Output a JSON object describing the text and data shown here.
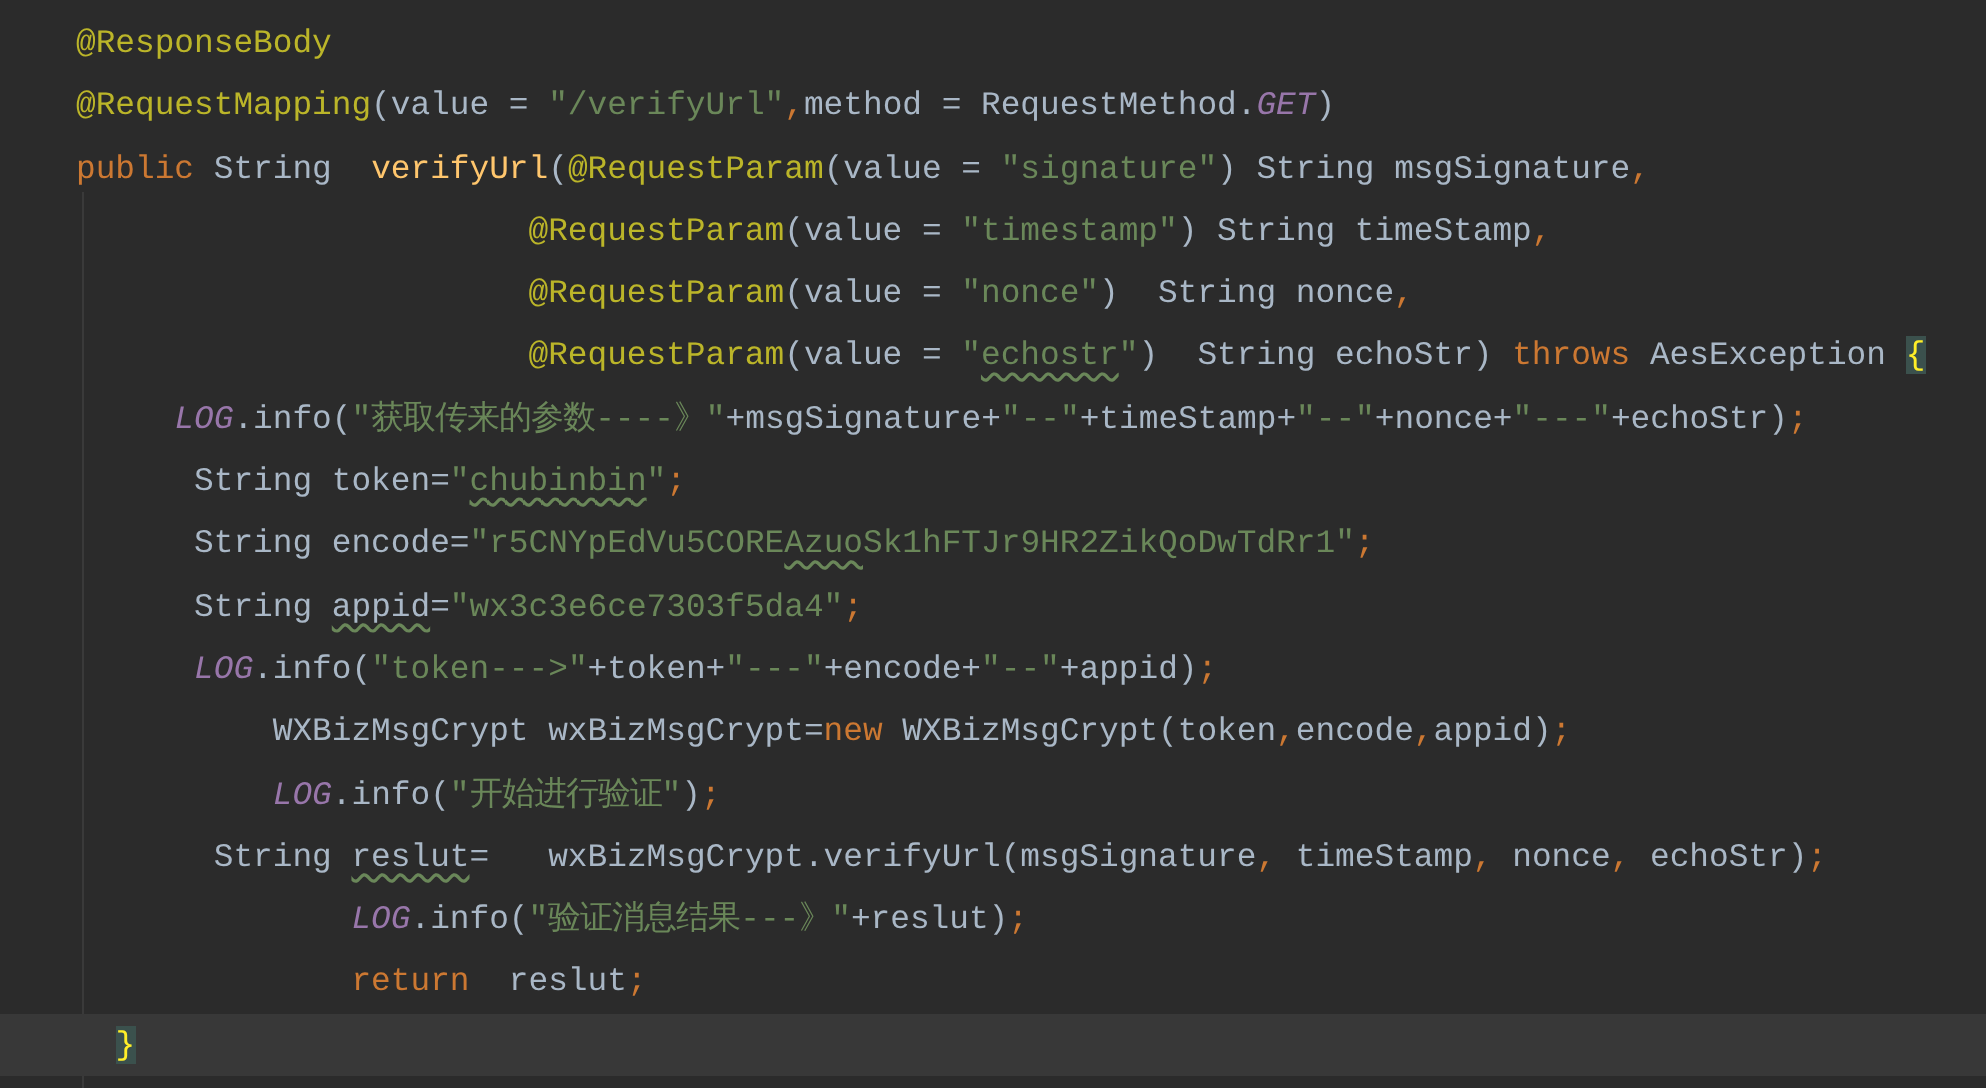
{
  "editor": {
    "lines": [
      {
        "current": false,
        "tokens": [
          {
            "kind": "annotation",
            "text": "@ResponseBody"
          }
        ]
      },
      {
        "current": false,
        "tokens": [
          {
            "kind": "annotation",
            "text": "@RequestMapping"
          },
          {
            "kind": "plain",
            "text": "(value = "
          },
          {
            "kind": "string",
            "text": "\"/verifyUrl\""
          },
          {
            "kind": "punct",
            "text": ","
          },
          {
            "kind": "plain",
            "text": "method = RequestMethod."
          },
          {
            "kind": "constant",
            "text": "GET"
          },
          {
            "kind": "plain",
            "text": ")"
          }
        ]
      },
      {
        "current": false,
        "tokens": [
          {
            "kind": "keyword",
            "text": "public "
          },
          {
            "kind": "plain",
            "text": "String  "
          },
          {
            "kind": "method",
            "text": "verifyUrl"
          },
          {
            "kind": "plain",
            "text": "("
          },
          {
            "kind": "annotation",
            "text": "@RequestParam"
          },
          {
            "kind": "plain",
            "text": "(value = "
          },
          {
            "kind": "string",
            "text": "\"signature\""
          },
          {
            "kind": "plain",
            "text": ") String msgSignature"
          },
          {
            "kind": "punct",
            "text": ","
          }
        ]
      },
      {
        "current": false,
        "tokens": [
          {
            "kind": "annotation",
            "text": "                       @RequestParam"
          },
          {
            "kind": "plain",
            "text": "(value = "
          },
          {
            "kind": "string",
            "text": "\"timestamp\""
          },
          {
            "kind": "plain",
            "text": ") String timeStamp"
          },
          {
            "kind": "punct",
            "text": ","
          }
        ]
      },
      {
        "current": false,
        "tokens": [
          {
            "kind": "annotation",
            "text": "                       @RequestParam"
          },
          {
            "kind": "plain",
            "text": "(value = "
          },
          {
            "kind": "string",
            "text": "\"nonce\""
          },
          {
            "kind": "plain",
            "text": ")  String nonce"
          },
          {
            "kind": "punct",
            "text": ","
          }
        ]
      },
      {
        "current": false,
        "tokens": [
          {
            "kind": "annotation",
            "text": "                       @RequestParam"
          },
          {
            "kind": "plain",
            "text": "(value = "
          },
          {
            "kind": "string",
            "text": "\""
          },
          {
            "kind": "string-typo",
            "text": "echostr"
          },
          {
            "kind": "string",
            "text": "\""
          },
          {
            "kind": "plain",
            "text": ")  String echoStr) "
          },
          {
            "kind": "keyword",
            "text": "throws "
          },
          {
            "kind": "plain",
            "text": "AesException "
          },
          {
            "kind": "brace",
            "text": "{"
          }
        ]
      },
      {
        "current": false,
        "tokens": [
          {
            "kind": "constant",
            "text": "     LOG"
          },
          {
            "kind": "plain",
            "text": ".info("
          },
          {
            "kind": "string",
            "text": "\"获取传来的参数----》\""
          },
          {
            "kind": "plain",
            "text": "+msgSignature+"
          },
          {
            "kind": "string",
            "text": "\"--\""
          },
          {
            "kind": "plain",
            "text": "+timeStamp+"
          },
          {
            "kind": "string",
            "text": "\"--\""
          },
          {
            "kind": "plain",
            "text": "+nonce+"
          },
          {
            "kind": "string",
            "text": "\"---\""
          },
          {
            "kind": "plain",
            "text": "+echoStr)"
          },
          {
            "kind": "punct",
            "text": ";"
          }
        ]
      },
      {
        "current": false,
        "tokens": [
          {
            "kind": "plain",
            "text": "      String token="
          },
          {
            "kind": "string",
            "text": "\""
          },
          {
            "kind": "string-typo",
            "text": "chubinbin"
          },
          {
            "kind": "string",
            "text": "\""
          },
          {
            "kind": "punct",
            "text": ";"
          }
        ]
      },
      {
        "current": false,
        "tokens": [
          {
            "kind": "plain",
            "text": "      String encode="
          },
          {
            "kind": "string",
            "text": "\"r5CNYpEdVu5CORE"
          },
          {
            "kind": "string-typo",
            "text": "Azuo"
          },
          {
            "kind": "string",
            "text": "Sk1hFTJr9HR2ZikQoDwTdRr1\""
          },
          {
            "kind": "punct",
            "text": ";"
          }
        ]
      },
      {
        "current": false,
        "tokens": [
          {
            "kind": "plain",
            "text": "      String "
          },
          {
            "kind": "plain-typo",
            "text": "appid"
          },
          {
            "kind": "plain",
            "text": "="
          },
          {
            "kind": "string",
            "text": "\"wx3c3e6ce7303f5da4\""
          },
          {
            "kind": "punct",
            "text": ";"
          }
        ]
      },
      {
        "current": false,
        "tokens": [
          {
            "kind": "constant",
            "text": "      LOG"
          },
          {
            "kind": "plain",
            "text": ".info("
          },
          {
            "kind": "string",
            "text": "\"token--->\""
          },
          {
            "kind": "plain",
            "text": "+token+"
          },
          {
            "kind": "string",
            "text": "\"---\""
          },
          {
            "kind": "plain",
            "text": "+encode+"
          },
          {
            "kind": "string",
            "text": "\"--\""
          },
          {
            "kind": "plain",
            "text": "+appid)"
          },
          {
            "kind": "punct",
            "text": ";"
          }
        ]
      },
      {
        "current": false,
        "tokens": [
          {
            "kind": "plain",
            "text": "          WXBizMsgCrypt wxBizMsgCrypt="
          },
          {
            "kind": "keyword",
            "text": "new "
          },
          {
            "kind": "plain",
            "text": "WXBizMsgCrypt(token"
          },
          {
            "kind": "punct",
            "text": ","
          },
          {
            "kind": "plain",
            "text": "encode"
          },
          {
            "kind": "punct",
            "text": ","
          },
          {
            "kind": "plain",
            "text": "appid)"
          },
          {
            "kind": "punct",
            "text": ";"
          }
        ]
      },
      {
        "current": false,
        "tokens": [
          {
            "kind": "constant",
            "text": "          LOG"
          },
          {
            "kind": "plain",
            "text": ".info("
          },
          {
            "kind": "string",
            "text": "\"开始进行验证\""
          },
          {
            "kind": "plain",
            "text": ")"
          },
          {
            "kind": "punct",
            "text": ";"
          }
        ]
      },
      {
        "current": false,
        "tokens": [
          {
            "kind": "plain",
            "text": "       String "
          },
          {
            "kind": "plain-typo",
            "text": "reslut"
          },
          {
            "kind": "plain",
            "text": "=   wxBizMsgCrypt.verifyUrl(msgSignature"
          },
          {
            "kind": "punct",
            "text": ","
          },
          {
            "kind": "plain",
            "text": " timeStamp"
          },
          {
            "kind": "punct",
            "text": ","
          },
          {
            "kind": "plain",
            "text": " nonce"
          },
          {
            "kind": "punct",
            "text": ","
          },
          {
            "kind": "plain",
            "text": " echoStr)"
          },
          {
            "kind": "punct",
            "text": ";"
          }
        ]
      },
      {
        "current": false,
        "tokens": [
          {
            "kind": "constant",
            "text": "              LOG"
          },
          {
            "kind": "plain",
            "text": ".info("
          },
          {
            "kind": "string",
            "text": "\"验证消息结果---》\""
          },
          {
            "kind": "plain",
            "text": "+reslut)"
          },
          {
            "kind": "punct",
            "text": ";"
          }
        ]
      },
      {
        "current": false,
        "tokens": [
          {
            "kind": "keyword",
            "text": "              return  "
          },
          {
            "kind": "plain",
            "text": "reslut"
          },
          {
            "kind": "punct",
            "text": ";"
          }
        ]
      },
      {
        "current": true,
        "tokens": [
          {
            "kind": "brace",
            "text": "  }"
          }
        ]
      }
    ]
  }
}
